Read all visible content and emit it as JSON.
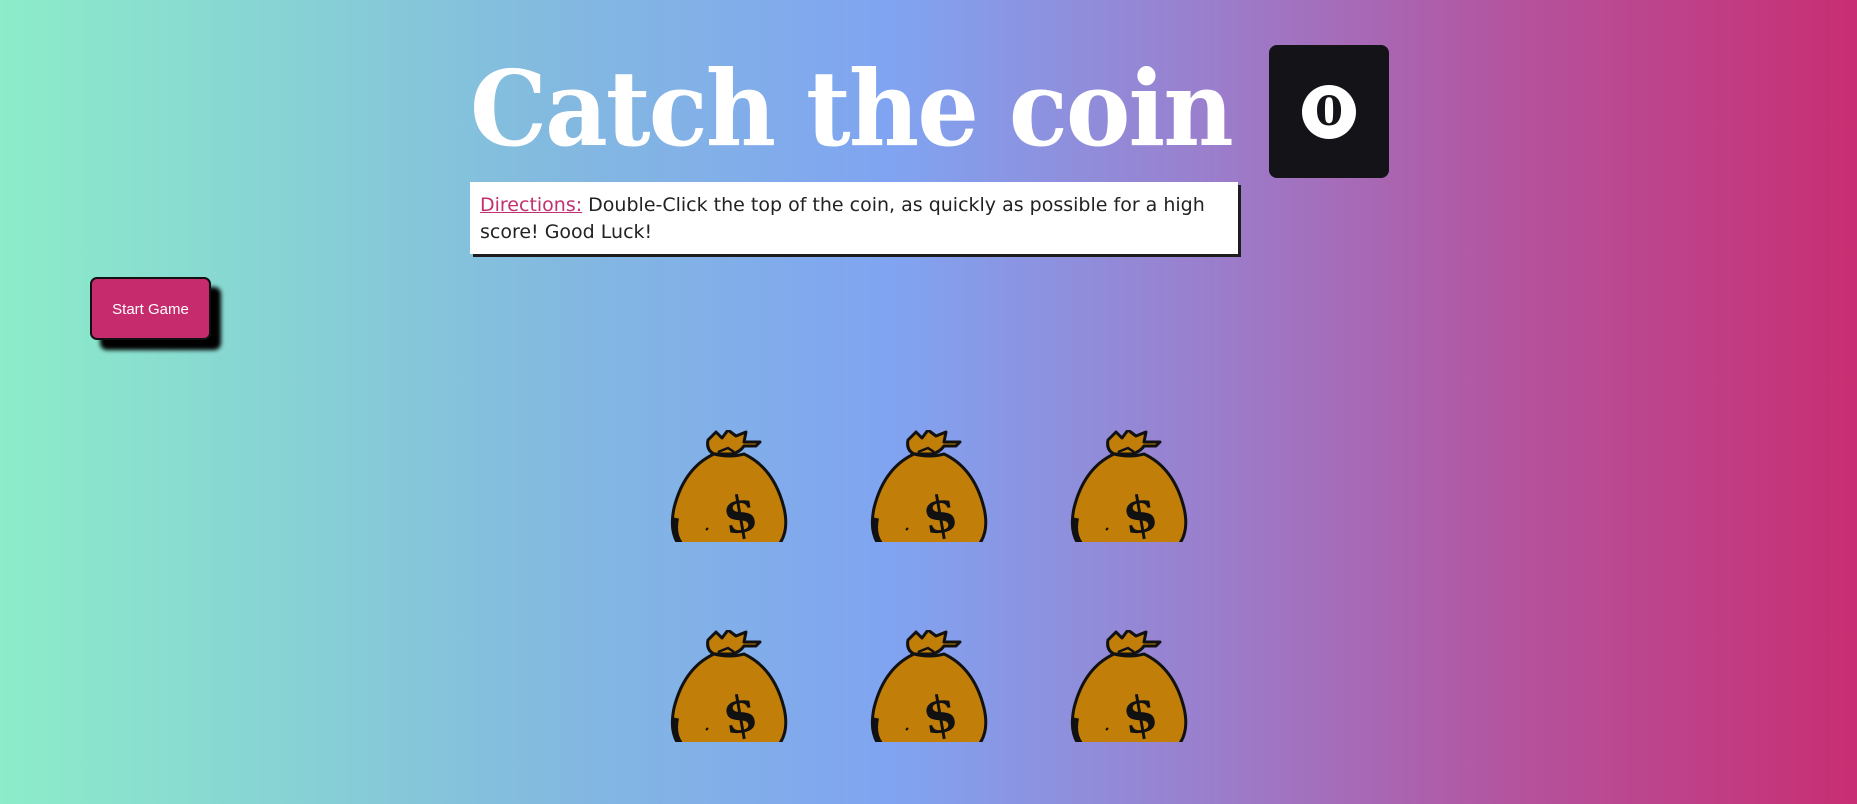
{
  "title": "Catch the coin",
  "score": {
    "value": "0"
  },
  "directions": {
    "label": "Directions:",
    "text": " Double-Click the top of the coin, as quickly as possible for a high score! Good Luck!"
  },
  "start_button": {
    "label": "Start Game"
  },
  "bags": [
    {
      "icon": "money-bag-icon"
    },
    {
      "icon": "money-bag-icon"
    },
    {
      "icon": "money-bag-icon"
    },
    {
      "icon": "money-bag-icon"
    },
    {
      "icon": "money-bag-icon"
    },
    {
      "icon": "money-bag-icon"
    }
  ],
  "colors": {
    "accent": "#c62b6d",
    "score_box": "#141317",
    "bag_fill": "#c17e08"
  }
}
